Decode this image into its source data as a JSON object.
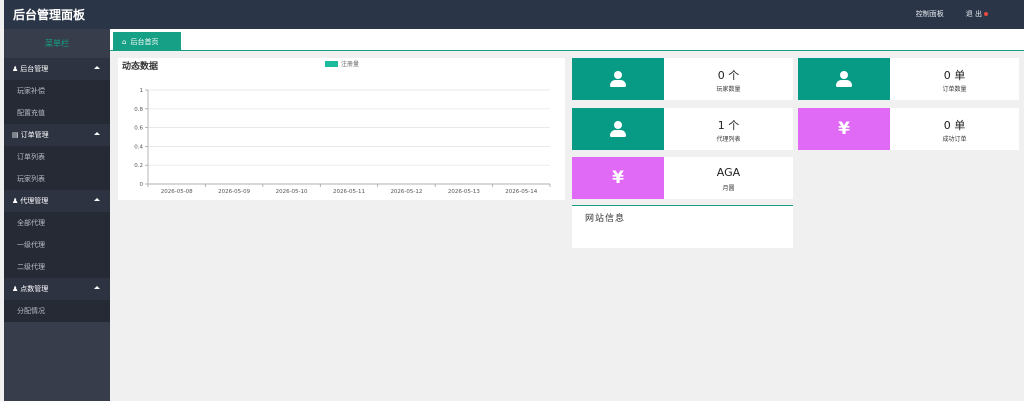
{
  "header": {
    "brand": "后台管理面板",
    "control_panel": "控制面板",
    "logout": "退 出"
  },
  "sidebar": {
    "title": "菜单栏",
    "groups": [
      {
        "label": "后台管理",
        "icon": "user-icon",
        "items": [
          "玩家补偿",
          "配置充值"
        ]
      },
      {
        "label": "订单管理",
        "icon": "bar-chart-icon",
        "items": [
          "订单列表",
          "玩家列表"
        ]
      },
      {
        "label": "代理管理",
        "icon": "user-icon",
        "items": [
          "全部代理",
          "一级代理",
          "二级代理"
        ]
      },
      {
        "label": "点数管理",
        "icon": "user-icon",
        "items": [
          "分配情况"
        ]
      }
    ]
  },
  "tabs": [
    {
      "label": "后台首页",
      "icon": "home-icon"
    }
  ],
  "colors": {
    "accent": "#16a085",
    "teal_box": "#079b85",
    "pink_box": "#e069f5",
    "topbar": "#2a3547",
    "sidebar": "#373d4b"
  },
  "chart_panel": {
    "title": "动态数据"
  },
  "chart_data": {
    "type": "line",
    "title": "动态数据",
    "legend": "注册量",
    "legend_position": "top",
    "categories": [
      "2026-05-08",
      "2026-05-09",
      "2026-05-10",
      "2026-05-11",
      "2026-05-12",
      "2026-05-13",
      "2026-05-14"
    ],
    "series": [
      {
        "name": "注册量",
        "values": [
          0,
          0,
          0,
          0,
          0,
          0,
          0
        ]
      }
    ],
    "yticks": [
      "0",
      "0.2",
      "0.4",
      "0.6",
      "0.8",
      "1"
    ],
    "ylim": [
      0,
      1
    ],
    "grid": true
  },
  "stats": [
    {
      "value": "0 个",
      "label": "玩家数量",
      "icon": "user-icon"
    },
    {
      "value": "0 单",
      "label": "订单数量",
      "icon": "user-icon"
    },
    {
      "value": "1 个",
      "label": "代理列表",
      "icon": "user-icon"
    },
    {
      "value": "0 单",
      "label": "成功订单",
      "icon": "yen-icon",
      "icon_text": "¥"
    },
    {
      "value": "AGA",
      "label": "月圆",
      "icon": "yen-icon",
      "icon_text": "¥"
    }
  ],
  "site_info": {
    "title": "网站信息"
  }
}
